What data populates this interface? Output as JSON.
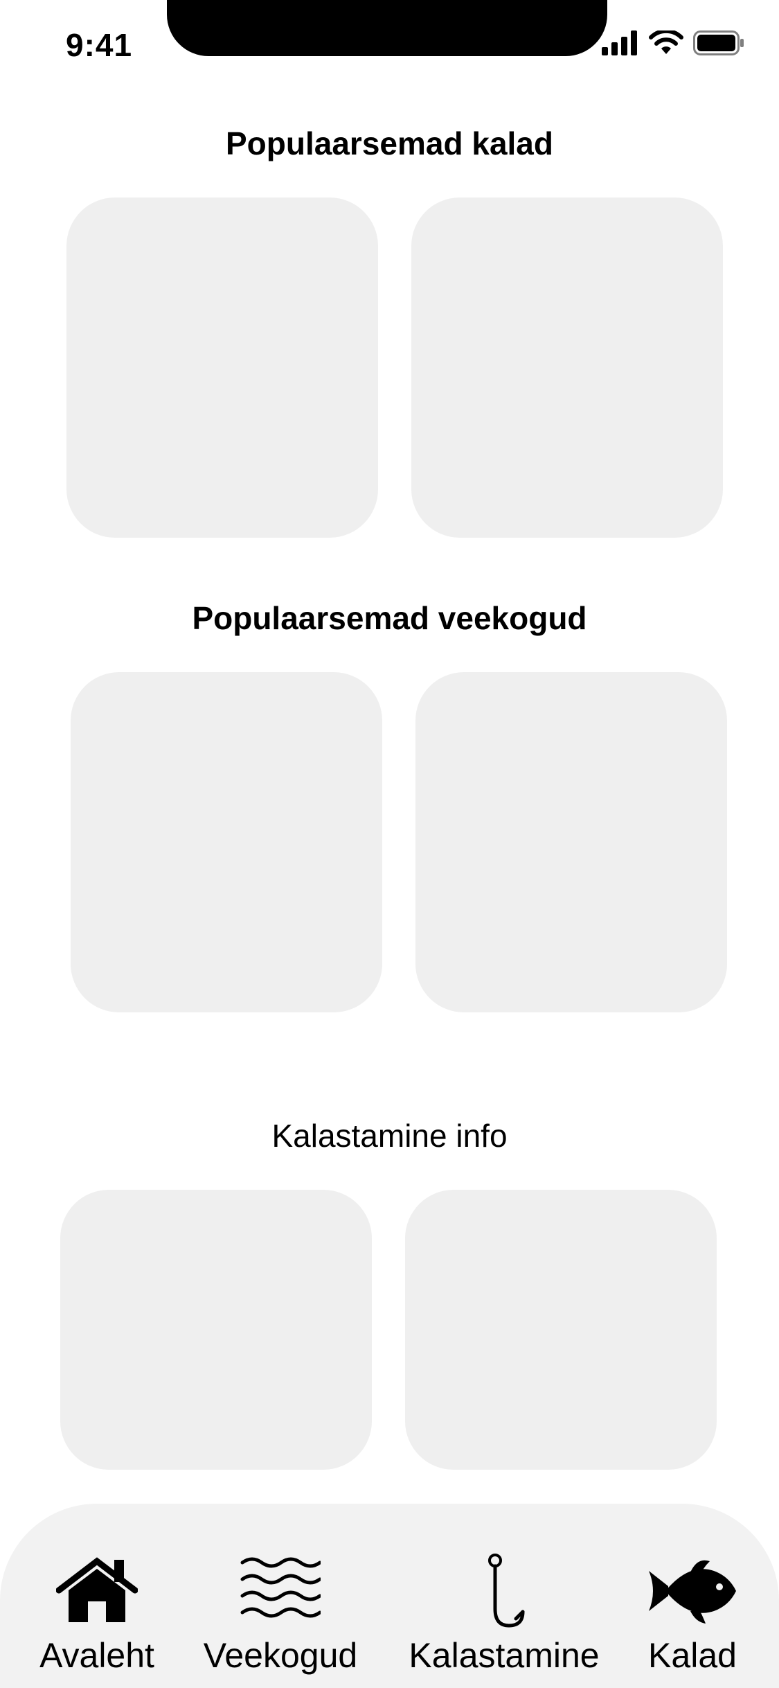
{
  "status_bar": {
    "time": "9:41",
    "icons": [
      "signal-icon",
      "wifi-icon",
      "battery-icon"
    ]
  },
  "sections": [
    {
      "title": "Populaarsemad kalad"
    },
    {
      "title": "Populaarsemad veekogud"
    },
    {
      "title": "Kalastamine info"
    }
  ],
  "tab_bar": {
    "items": [
      {
        "label": "Avaleht",
        "icon": "house-icon"
      },
      {
        "label": "Veekogud",
        "icon": "waves-icon"
      },
      {
        "label": "Kalastamine",
        "icon": "fishing-hook-icon"
      },
      {
        "label": "Kalad",
        "icon": "fish-icon"
      }
    ]
  },
  "colors": {
    "card_placeholder": "#efefef",
    "tab_bar_background": "#f2f2f2",
    "text": "#000000"
  }
}
